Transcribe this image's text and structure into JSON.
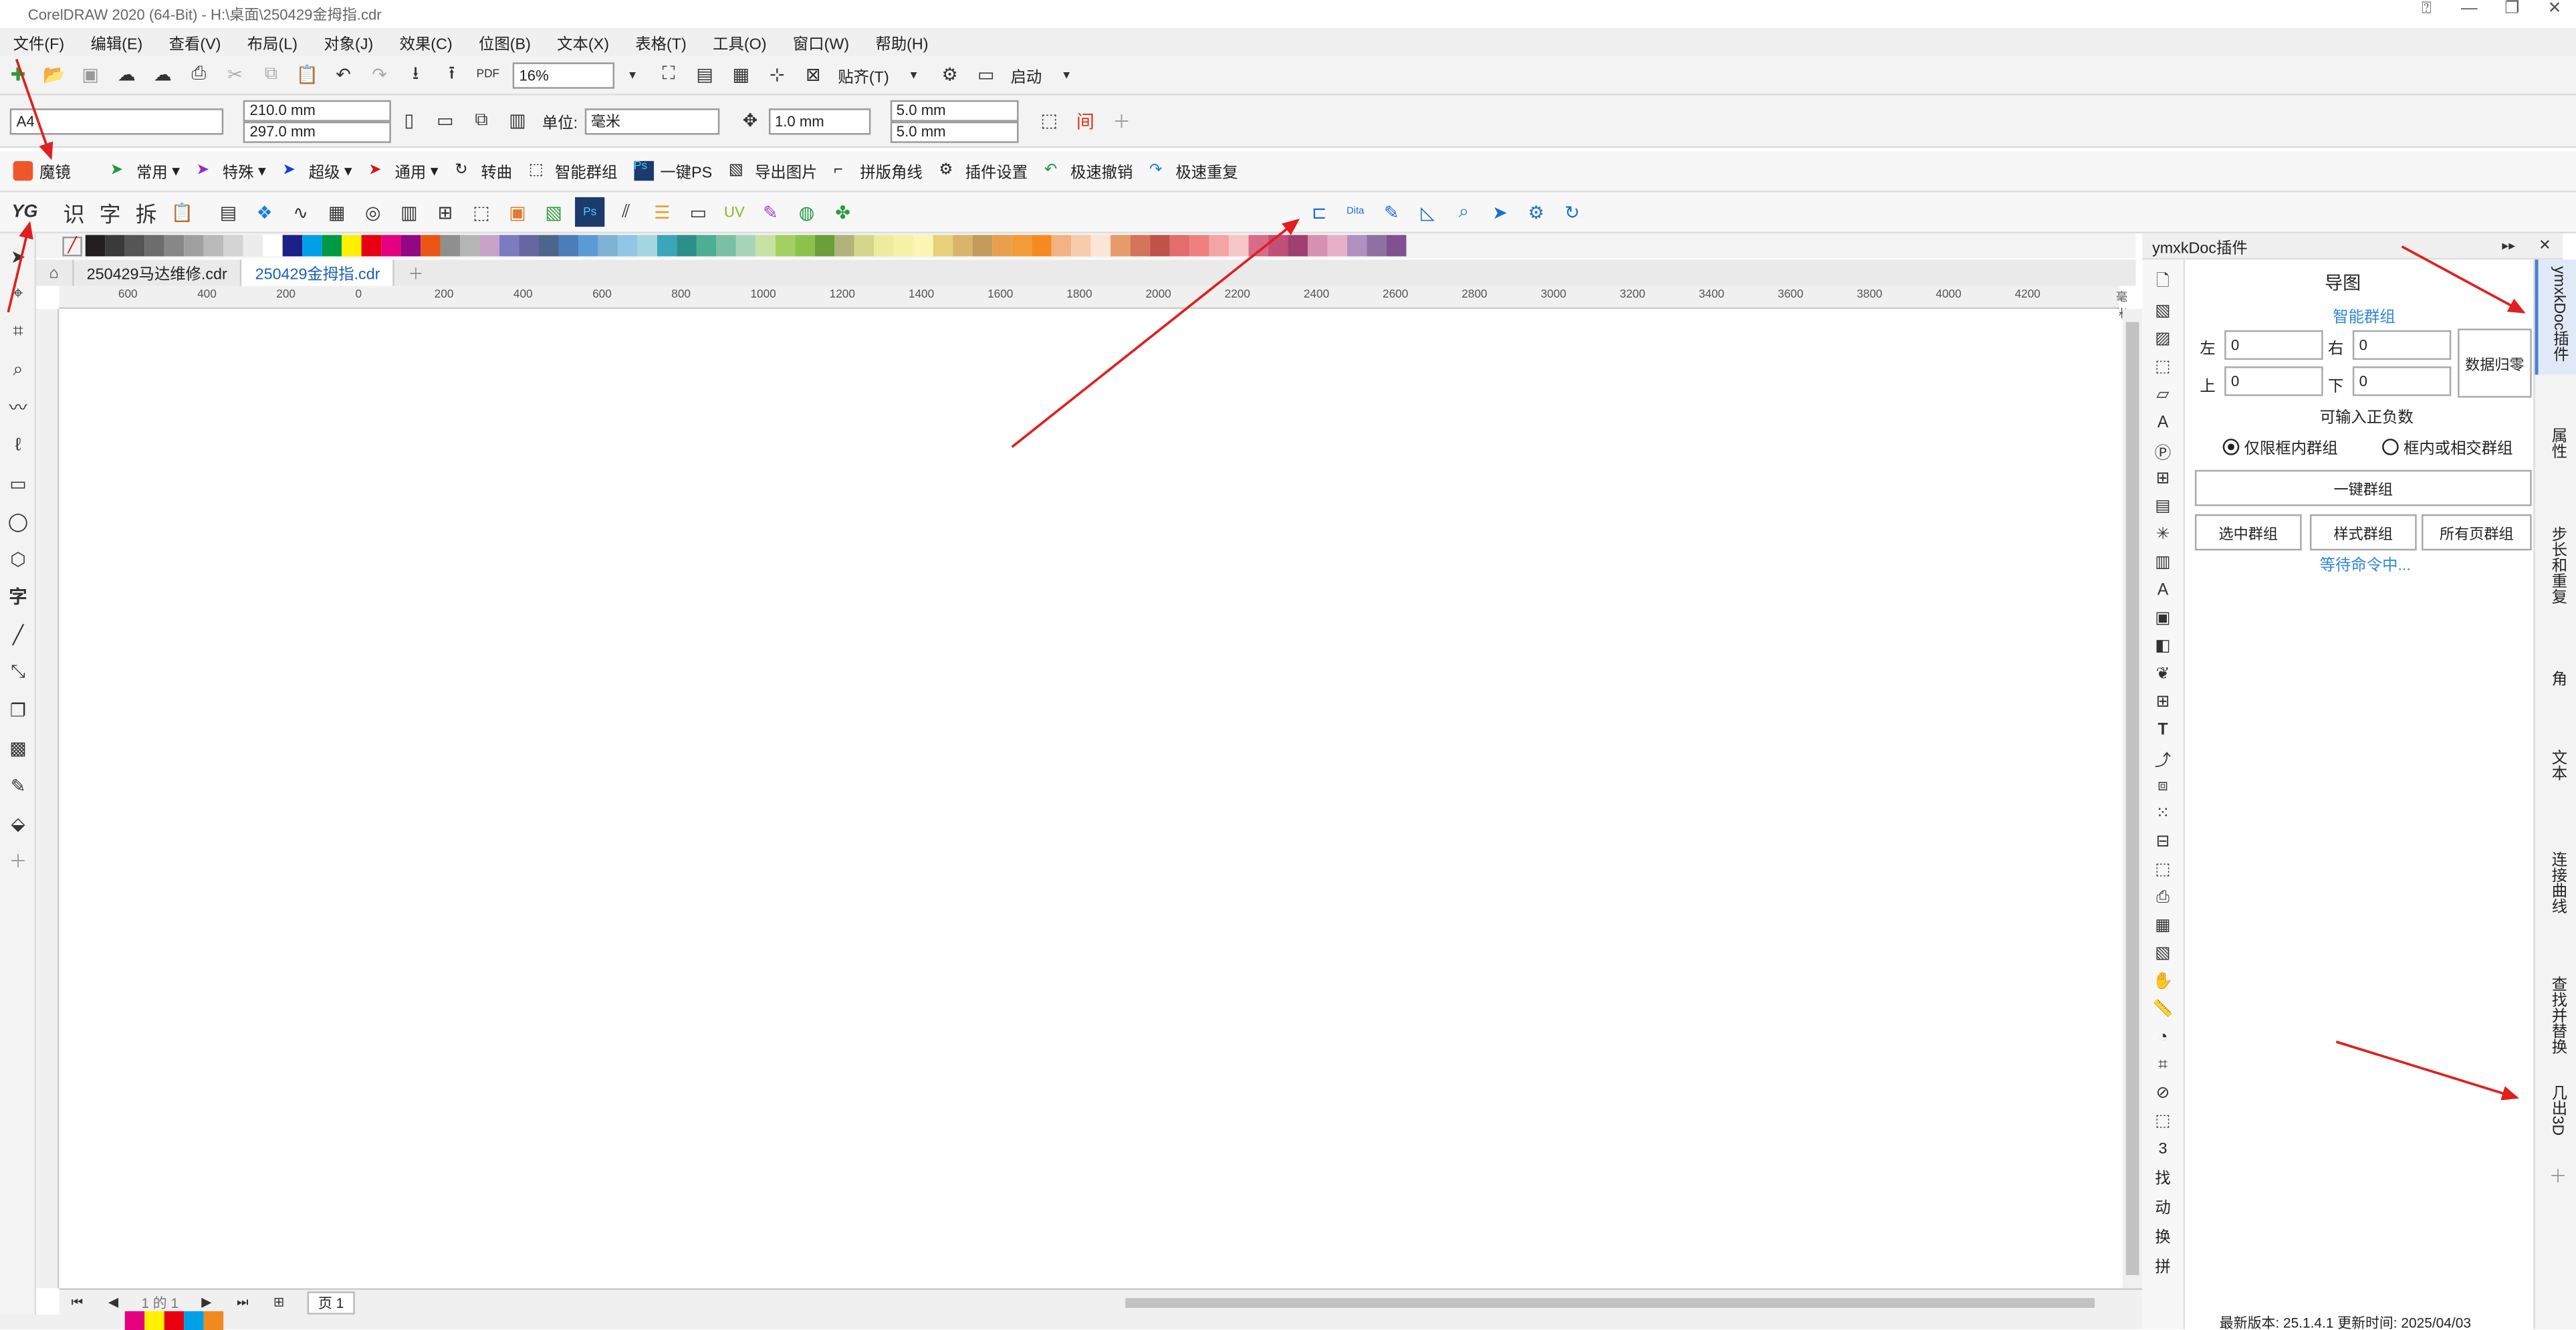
{
  "titlebar": {
    "title": "CorelDRAW 2020 (64-Bit) - H:\\桌面\\250429金拇指.cdr"
  },
  "menu": [
    "文件(F)",
    "编辑(E)",
    "查看(V)",
    "布局(L)",
    "对象(J)",
    "效果(C)",
    "位图(B)",
    "文本(X)",
    "表格(T)",
    "工具(O)",
    "窗口(W)",
    "帮助(H)"
  ],
  "toolbar1": {
    "zoom": "16%",
    "snap": "贴齐(T)",
    "launch": "启动"
  },
  "toolbar2": {
    "page_size": "A4",
    "width": "210.0 mm",
    "height": "297.0 mm",
    "unit_label": "单位:",
    "unit": "毫米",
    "nudge": "1.0 mm",
    "dup_x": "5.0 mm",
    "dup_y": "5.0 mm"
  },
  "toolbar3": {
    "items": [
      "魔镜",
      "常用",
      "特殊",
      "超级",
      "通用",
      "转曲",
      "智能群组",
      "一键PS",
      "导出图片",
      "拼版角线",
      "插件设置",
      "极速撤销",
      "极速重复"
    ]
  },
  "toolbar4": {
    "items": [
      "识",
      "字",
      "拆"
    ]
  },
  "palette": [
    "#231f20",
    "#3a3a3a",
    "#555",
    "#6d6d6d",
    "#878787",
    "#a0a0a0",
    "#bababa",
    "#d4d4d4",
    "#ececec",
    "#ffffff",
    "#1d2087",
    "#00a0e9",
    "#009944",
    "#fff100",
    "#e60012",
    "#e4007f",
    "#920783",
    "#ea5514",
    "#8f8f8f",
    "#b5b5b5",
    "#c8a2c8",
    "#7b7bc0",
    "#6666a3",
    "#4d648d",
    "#4a7dba",
    "#5b9bd5",
    "#7fb3d5",
    "#93c5e6",
    "#a4d6e0",
    "#3aa6b9",
    "#2c8f8a",
    "#4caf93",
    "#7ac0a4",
    "#a8d5ba",
    "#c7e3a3",
    "#a3cf62",
    "#8bc34a",
    "#6a9f3b",
    "#b2b27a",
    "#d6d68a",
    "#ecec9c",
    "#f5f2a6",
    "#fdf5b3",
    "#e8d17a",
    "#d9b46a",
    "#c49a5a",
    "#e8a04c",
    "#f29b38",
    "#f58a1f",
    "#f4b183",
    "#f8cbad",
    "#fce4d6",
    "#e89a6a",
    "#d4745a",
    "#c0524a",
    "#e36c6c",
    "#f08080",
    "#f4a4a4",
    "#f7c6c6",
    "#d86a8a",
    "#c05078",
    "#a04070",
    "#d890b0",
    "#e8b0c8",
    "#b090c0",
    "#9070a0",
    "#805090"
  ],
  "tabs": [
    "250429马达维修.cdr",
    "250429金拇指.cdr"
  ],
  "ruler_ticks": [
    "600",
    "400",
    "200",
    "0",
    "200",
    "400",
    "600",
    "800",
    "1000",
    "1200",
    "1400",
    "1600",
    "1800",
    "2000",
    "2200",
    "2400",
    "2600",
    "2800",
    "3000",
    "3200",
    "3400",
    "3600",
    "3800",
    "4000",
    "4200",
    "毫米"
  ],
  "bottombar": {
    "page_of": "1  的  1",
    "page_tab": "页 1"
  },
  "panel": {
    "title": "ymxkDoc插件",
    "heading": "导图",
    "smart_group": "智能群组",
    "left_label": "左",
    "left_value": "0",
    "right_label": "右",
    "right_value": "0",
    "top_label": "上",
    "top_value": "0",
    "bottom_label": "下",
    "bottom_value": "0",
    "reset_button": "数据归零",
    "hint": "可输入正负数",
    "radio_inside": "仅限框内群组",
    "radio_intersect": "框内或相交群组",
    "one_key_group": "一键群组",
    "select_group": "选中群组",
    "style_group": "样式群组",
    "all_pages_group": "所有页群组",
    "waiting": "等待命令中...",
    "footer": "最新版本: 25.1.4.1 更新时间: 2025/04/03"
  },
  "iconcol_text": [
    "3",
    "找",
    "动",
    "换",
    "拼"
  ],
  "right_tabs": [
    "ymxkDoc插件",
    "属性",
    "步长和重复",
    "角",
    "文本",
    "连接曲线",
    "查找并替换",
    "几出3D"
  ]
}
